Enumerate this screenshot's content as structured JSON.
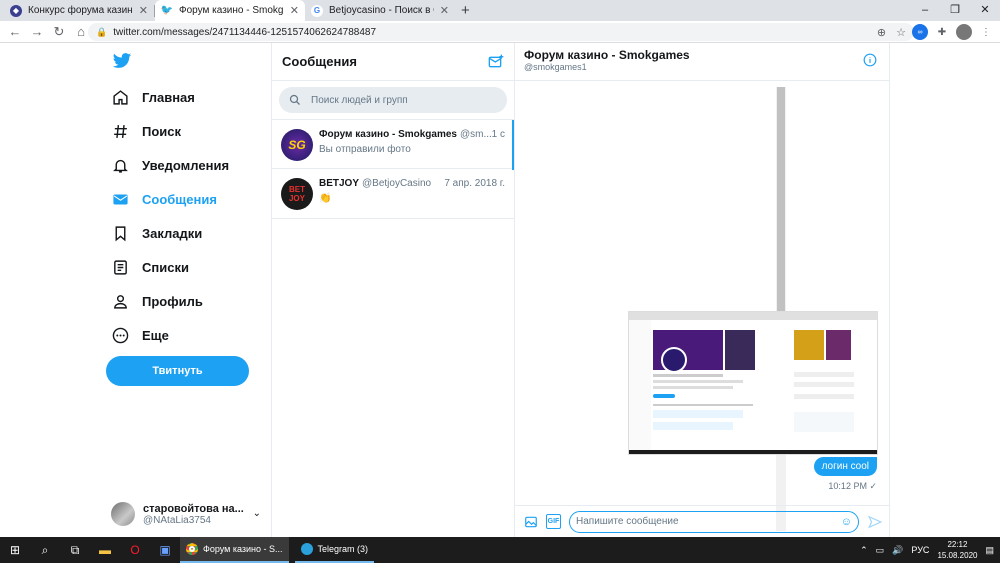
{
  "browser": {
    "tabs": [
      {
        "label": "Конкурс форума казино",
        "icon_color": "#3b3f8f",
        "active": false
      },
      {
        "label": "Форум казино - Smokgames / Тв",
        "icon_color": "#1da1f2",
        "active": true
      },
      {
        "label": "Betjoycasino - Поиск в Google",
        "icon_color": "#4285f4",
        "active": false
      }
    ],
    "url": "twitter.com/messages/2471134446-1251574062624788487",
    "window_controls": [
      "–",
      "❐",
      "✕"
    ]
  },
  "nav": {
    "items": [
      {
        "label": "Главная",
        "icon": "home-icon"
      },
      {
        "label": "Поиск",
        "icon": "hash-icon"
      },
      {
        "label": "Уведомления",
        "icon": "bell-icon"
      },
      {
        "label": "Сообщения",
        "icon": "envelope-icon",
        "active": true
      },
      {
        "label": "Закладки",
        "icon": "bookmark-icon"
      },
      {
        "label": "Списки",
        "icon": "list-icon"
      },
      {
        "label": "Профиль",
        "icon": "person-icon"
      },
      {
        "label": "Еще",
        "icon": "more-icon"
      }
    ],
    "tweet_button": "Твитнуть",
    "account": {
      "name": "старовойтова на...",
      "handle": "@NAtaLia3754"
    }
  },
  "messages": {
    "title": "Сообщения",
    "search_placeholder": "Поиск людей и групп",
    "conversations": [
      {
        "name": "Форум казино - Smokgames",
        "handle": "@sm...",
        "date": "1 с",
        "last": "Вы отправили фото",
        "avatar_text": "SG",
        "avatar_color": "#2a1a6e"
      },
      {
        "name": "BETJOY",
        "handle": "@BetjoyCasino",
        "date": "7 апр. 2018 г.",
        "last": "👏",
        "avatar_text": "BET JOY",
        "avatar_color": "#1a1a1a"
      }
    ]
  },
  "chat": {
    "title": "Форум казино - Smokgames",
    "handle": "@smokgames1",
    "message_text": "логин cool",
    "message_time": "10:12 PM ✓",
    "input_placeholder": "Напишите сообщение",
    "gif_label": "GIF"
  },
  "taskbar": {
    "apps": [
      {
        "label": "Форум казино - S...",
        "icon_color": "#ea4335",
        "active": true
      },
      {
        "label": "Telegram (3)",
        "icon_color": "#2aa1da",
        "active": false
      }
    ],
    "lang": "РУС",
    "time": "22:12",
    "date": "15.08.2020"
  }
}
